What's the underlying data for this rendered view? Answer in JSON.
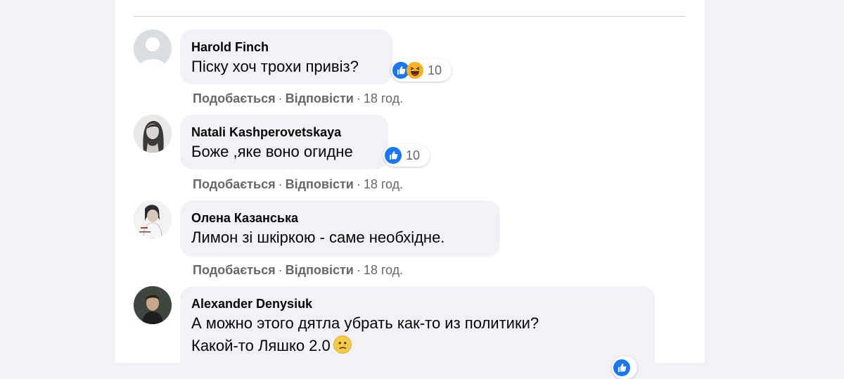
{
  "colors": {
    "page_bg": "#f0f2f5",
    "panel_bg": "#ffffff",
    "bubble_bg": "#f0f2f5",
    "like_blue": "#1877f2",
    "haha_yellow": "#f7b125",
    "meta_gray": "#65676b"
  },
  "comments": [
    {
      "author": "Harold Finch",
      "text": "Піску хоч трохи привіз?",
      "reactions": {
        "icons": [
          "like-icon",
          "haha-icon"
        ],
        "count": "10"
      },
      "actions": {
        "like": "Подобається",
        "reply": "Відповісти",
        "time": "18 год."
      },
      "avatar": "default-avatar"
    },
    {
      "author": "Natali Kashperovetskaya",
      "text": "Боже ,яке воно огидне",
      "reactions": {
        "icons": [
          "like-icon"
        ],
        "count": "10"
      },
      "actions": {
        "like": "Подобається",
        "reply": "Відповісти",
        "time": "18 год."
      },
      "avatar": "woman-portrait-avatar"
    },
    {
      "author": "Олена Казанська",
      "text": "Лимон зі шкіркою - саме необхідне.",
      "actions": {
        "like": "Подобається",
        "reply": "Відповісти",
        "time": "18 год."
      },
      "avatar": "woman-profile-avatar"
    },
    {
      "author": "Alexander Denysiuk",
      "text_line1": "А можно этого дятла убрать как-то из политики?",
      "text_line2": "Какой-то Ляшко 2.0",
      "emoji": "confused-face-icon",
      "avatar": "man-portrait-avatar"
    }
  ],
  "separator": "·"
}
